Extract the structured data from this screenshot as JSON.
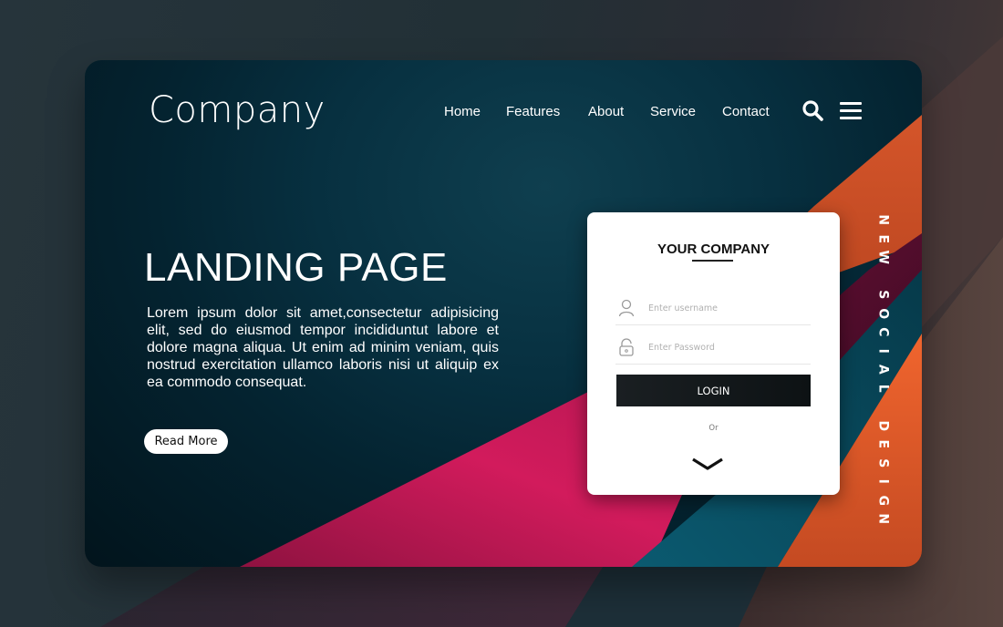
{
  "brand": {
    "logo": "Company"
  },
  "nav": {
    "items": [
      {
        "label": "Home"
      },
      {
        "label": "Features"
      },
      {
        "label": "About"
      },
      {
        "label": "Service"
      },
      {
        "label": "Contact"
      }
    ],
    "search_icon": "search-icon",
    "menu_icon": "hamburger-menu-icon"
  },
  "hero": {
    "title": "LANDING PAGE",
    "body": "Lorem ipsum dolor sit amet,consectetur adipisicing elit, sed do eiusmod  tempor  incididuntut  labore  et dolore magna aliqua. Ut enim ad minim  veniam, quis nostrud exercitation  ullamco  laboris  nisi  ut  aliquip  ex  ea commodo consequat.",
    "cta_label": "Read More"
  },
  "login": {
    "title": "YOUR COMPANY",
    "username": {
      "value": "",
      "placeholder": "Enter username",
      "icon": "user-icon"
    },
    "password": {
      "value": "",
      "placeholder": "Enter Password",
      "icon": "lock-icon"
    },
    "button_label": "LOGIN",
    "or_label": "Or",
    "expand_icon": "chevron-down-icon"
  },
  "side_label": "NEW SOCIAL DESIGN",
  "colors": {
    "card_dark": "#042330",
    "teal": "#0a5a6e",
    "magenta": "#c8185a",
    "orange": "#e0582a",
    "plum": "#5a1030",
    "button_dark": "#14191c"
  }
}
